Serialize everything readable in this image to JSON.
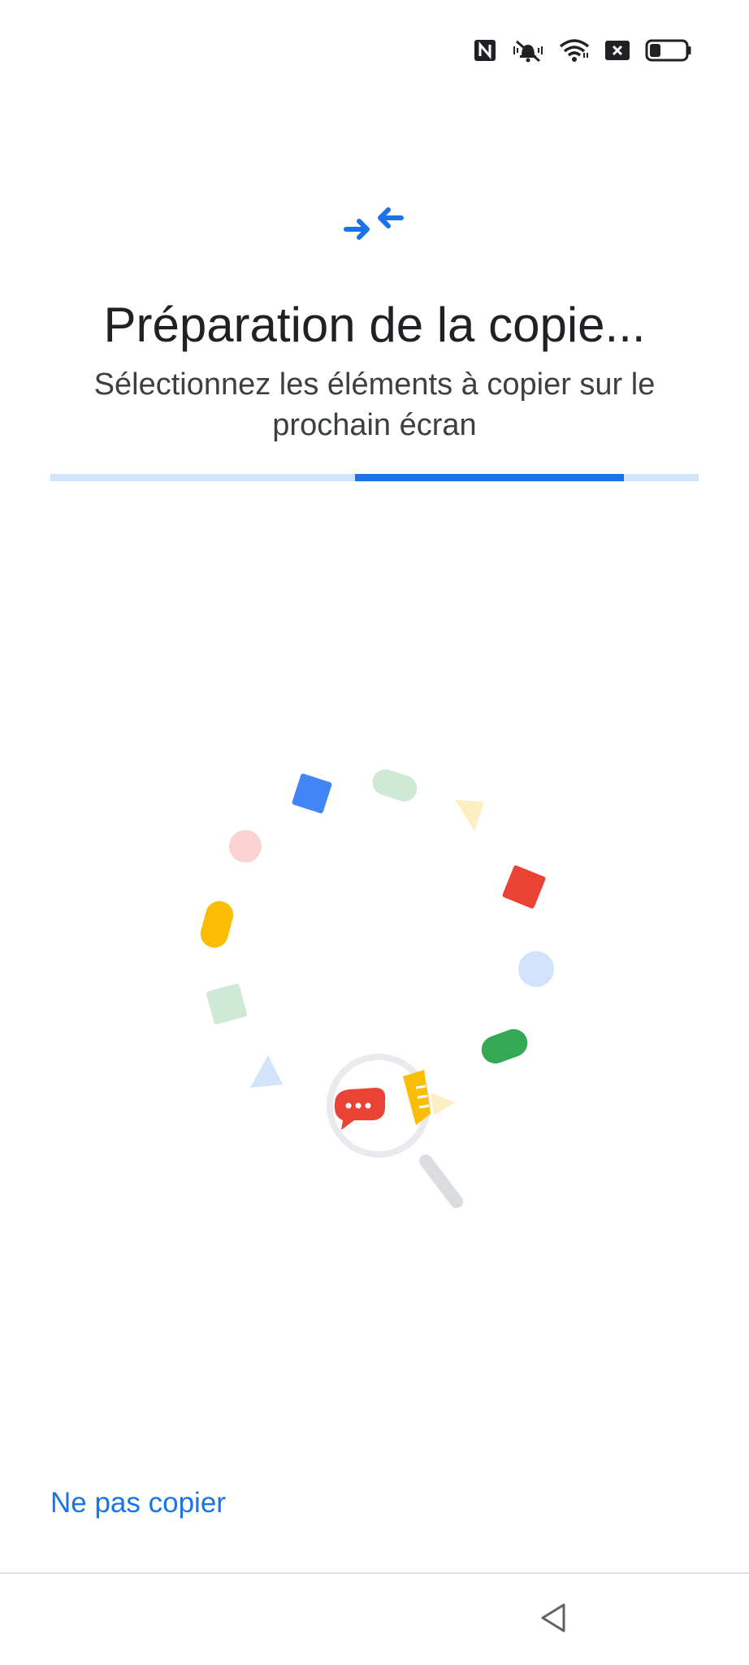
{
  "status_bar": {
    "icons": [
      "nfc-icon",
      "vibrate-icon",
      "wifi-icon",
      "no-sim-icon",
      "battery-icon"
    ],
    "battery_level": 0.3
  },
  "header": {
    "icon": "transfer-arrows-icon",
    "title": "Préparation de la copie...",
    "subtitle": "Sélectionnez les éléments à copier sur le prochain écran"
  },
  "progress": {
    "type": "indeterminate",
    "segment_start": 0.47,
    "segment_end": 0.885
  },
  "illustration": {
    "name": "searching-data-illustration",
    "colors": {
      "blue": "#4285f4",
      "red": "#ea4335",
      "yellow": "#fbbc04",
      "green": "#34a853",
      "light_blue": "#d2e3fc",
      "light_red": "#fad2cf",
      "light_yellow": "#feefc3",
      "light_green": "#ceead6",
      "glass": "#e8eaed"
    }
  },
  "actions": {
    "skip_label": "Ne pas copier"
  },
  "nav": {
    "back_icon": "back-triangle-icon"
  },
  "colors": {
    "accent": "#1a73e8",
    "track": "#d2e3fc"
  }
}
